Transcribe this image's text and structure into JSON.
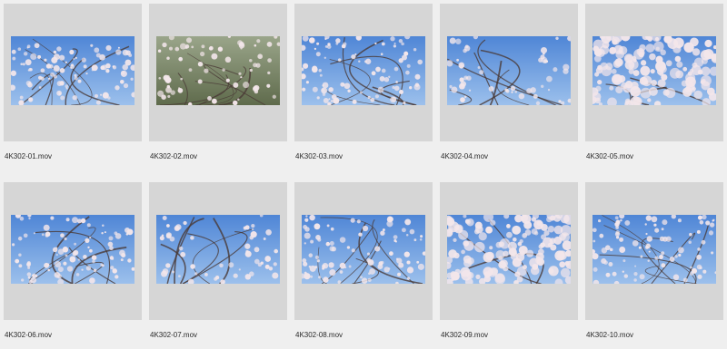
{
  "files": [
    {
      "name": "4K302-01.mov",
      "thumbnail": "cherry-tree-wide-branches"
    },
    {
      "name": "4K302-02.mov",
      "thumbnail": "cherry-blossoms-over-pond"
    },
    {
      "name": "4K302-03.mov",
      "thumbnail": "cherry-blossom-branches-blue-sky"
    },
    {
      "name": "4K302-04.mov",
      "thumbnail": "cherry-trees-framing-sky"
    },
    {
      "name": "4K302-05.mov",
      "thumbnail": "cherry-blossom-closeup-clusters"
    },
    {
      "name": "4K302-06.mov",
      "thumbnail": "cherry-blossom-branch-blue-sky"
    },
    {
      "name": "4K302-07.mov",
      "thumbnail": "cherry-canopy-looking-up"
    },
    {
      "name": "4K302-08.mov",
      "thumbnail": "cherry-branches-dense-sky"
    },
    {
      "name": "4K302-09.mov",
      "thumbnail": "cherry-blossom-macro-white"
    },
    {
      "name": "4K302-10.mov",
      "thumbnail": "cherry-blossom-branches-sky"
    }
  ],
  "colors": {
    "background": "#efefef",
    "tile": "#d6d6d6",
    "sky": "#6f9ee0",
    "blossom": "#f3e6ea",
    "branch": "#4a3a36"
  }
}
